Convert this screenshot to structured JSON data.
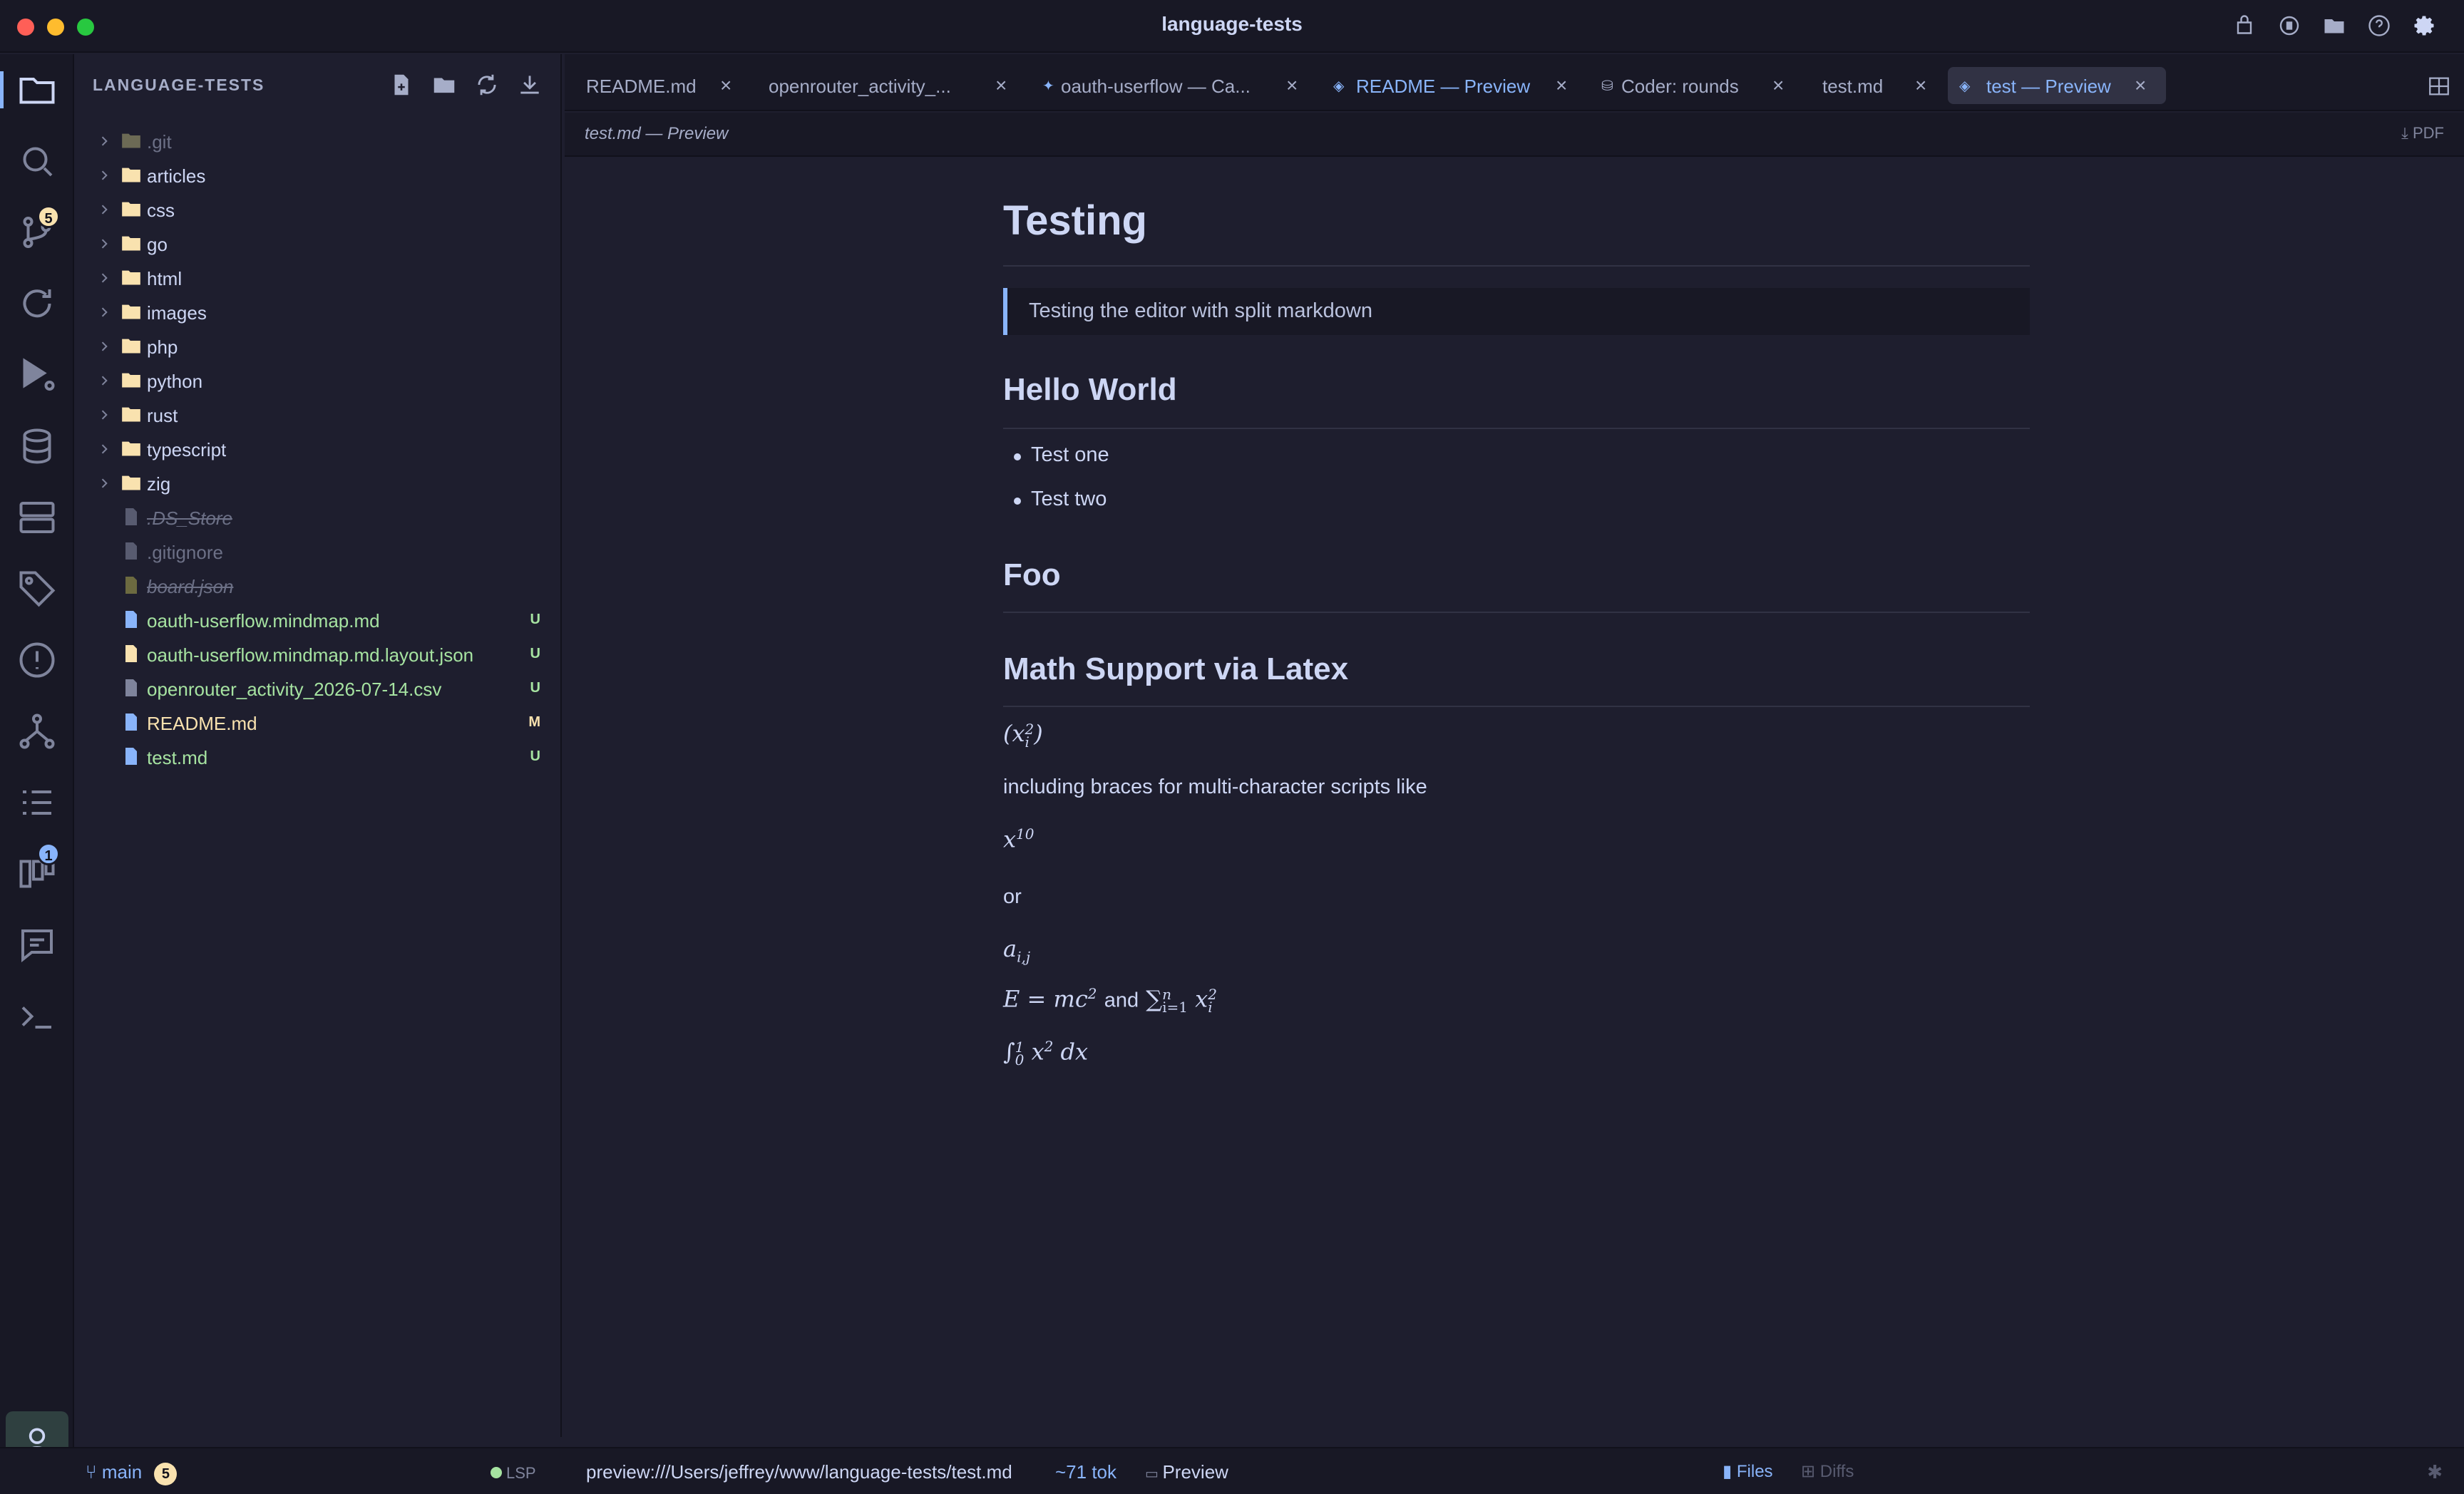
{
  "window": {
    "title": "language-tests",
    "traffic_lights": [
      "#ff5f57",
      "#febc2e",
      "#28c840"
    ],
    "title_icons": [
      "extensions-icon",
      "record-icon",
      "folder-icon",
      "help-icon",
      "gear-icon"
    ]
  },
  "activity_bar": {
    "items": [
      {
        "name": "explorer-icon",
        "active": true
      },
      {
        "name": "search-icon"
      },
      {
        "name": "source-control-icon",
        "badge": "5"
      },
      {
        "name": "refresh-icon"
      },
      {
        "name": "run-debug-icon"
      },
      {
        "name": "database-icon"
      },
      {
        "name": "server-icon"
      },
      {
        "name": "tag-icon"
      },
      {
        "name": "problems-icon"
      },
      {
        "name": "graph-icon"
      },
      {
        "name": "tasks-icon"
      },
      {
        "name": "board-icon",
        "badge": "1"
      },
      {
        "name": "chat-icon"
      },
      {
        "name": "terminal-icon"
      }
    ],
    "account": "account-icon"
  },
  "sidebar": {
    "title": "LANGUAGE-TESTS",
    "actions": [
      "new-file-icon",
      "new-folder-icon",
      "refresh-icon",
      "collapse-icon"
    ],
    "tree": [
      {
        "name": ".git",
        "type": "folder",
        "state": "dim"
      },
      {
        "name": "articles",
        "type": "folder"
      },
      {
        "name": "css",
        "type": "folder"
      },
      {
        "name": "go",
        "type": "folder"
      },
      {
        "name": "html",
        "type": "folder"
      },
      {
        "name": "images",
        "type": "folder"
      },
      {
        "name": "php",
        "type": "folder"
      },
      {
        "name": "python",
        "type": "folder"
      },
      {
        "name": "rust",
        "type": "folder"
      },
      {
        "name": "typescript",
        "type": "folder"
      },
      {
        "name": "zig",
        "type": "folder"
      },
      {
        "name": ".DS_Store",
        "type": "file",
        "state": "ignored"
      },
      {
        "name": ".gitignore",
        "type": "file",
        "state": "dim"
      },
      {
        "name": "board.json",
        "type": "file",
        "state": "ignored"
      },
      {
        "name": "oauth-userflow.mindmap.md",
        "type": "file",
        "state": "untracked",
        "git": "U"
      },
      {
        "name": "oauth-userflow.mindmap.md.layout.json",
        "type": "file",
        "state": "untracked",
        "git": "U"
      },
      {
        "name": "openrouter_activity_2026-07-14.csv",
        "type": "file",
        "state": "untracked",
        "git": "U"
      },
      {
        "name": "README.md",
        "type": "file",
        "state": "modified",
        "git": "M"
      },
      {
        "name": "test.md",
        "type": "file",
        "state": "untracked",
        "git": "U"
      }
    ]
  },
  "tabs": [
    {
      "label": "README.md"
    },
    {
      "label": "openrouter_activity_..."
    },
    {
      "label": "oauth-userflow — Ca...",
      "icon": "✦"
    },
    {
      "label": "README — Preview",
      "icon": "◈",
      "preview": true
    },
    {
      "label": "Coder: rounds",
      "icon": "⛁"
    },
    {
      "label": "test.md"
    },
    {
      "label": "test — Preview",
      "icon": "◈",
      "active": true
    }
  ],
  "breadcrumb": {
    "path": "test.md — Preview",
    "pdf": "PDF"
  },
  "document": {
    "h1": "Testing",
    "quote": "Testing the editor with split markdown",
    "h2_hello": "Hello World",
    "bullets": [
      "Test one",
      "Test two"
    ],
    "h2_foo": "Foo",
    "h2_math": "Math Support via Latex",
    "p_braces": "including braces for multi-character scripts like",
    "p_or": "or",
    "p_and": "and",
    "math": {
      "var_x": "x",
      "idx_i": "i",
      "pow_2": "2",
      "pow_10": "10",
      "var_a": "a",
      "idx_ij": "i,j",
      "energy_lhs": "E",
      "equals": "=",
      "energy_rhs": "mc",
      "sum": "∑",
      "sum_upper": "n",
      "sum_lower": "i=1",
      "integral": "∫",
      "int_lower": "0",
      "int_upper": "1",
      "dx": "dx",
      "lparen": "(",
      "rparen": ")"
    }
  },
  "statusbar": {
    "branch": "main",
    "branch_badge": "5",
    "lsp": "LSP",
    "path": "preview:///Users/jeffrey/www/language-tests/test.md",
    "tokens": "~71 tok",
    "mode": "Preview",
    "files": "Files",
    "diffs": "Diffs"
  },
  "colors": {
    "accent": "#89b4fa",
    "untracked": "#a6e3a1",
    "modified": "#f9e2af",
    "folder": "#f9e2af",
    "file": "#89b4fa",
    "badge_yellow": "#f9e2af",
    "badge_blue": "#89b4fa"
  }
}
